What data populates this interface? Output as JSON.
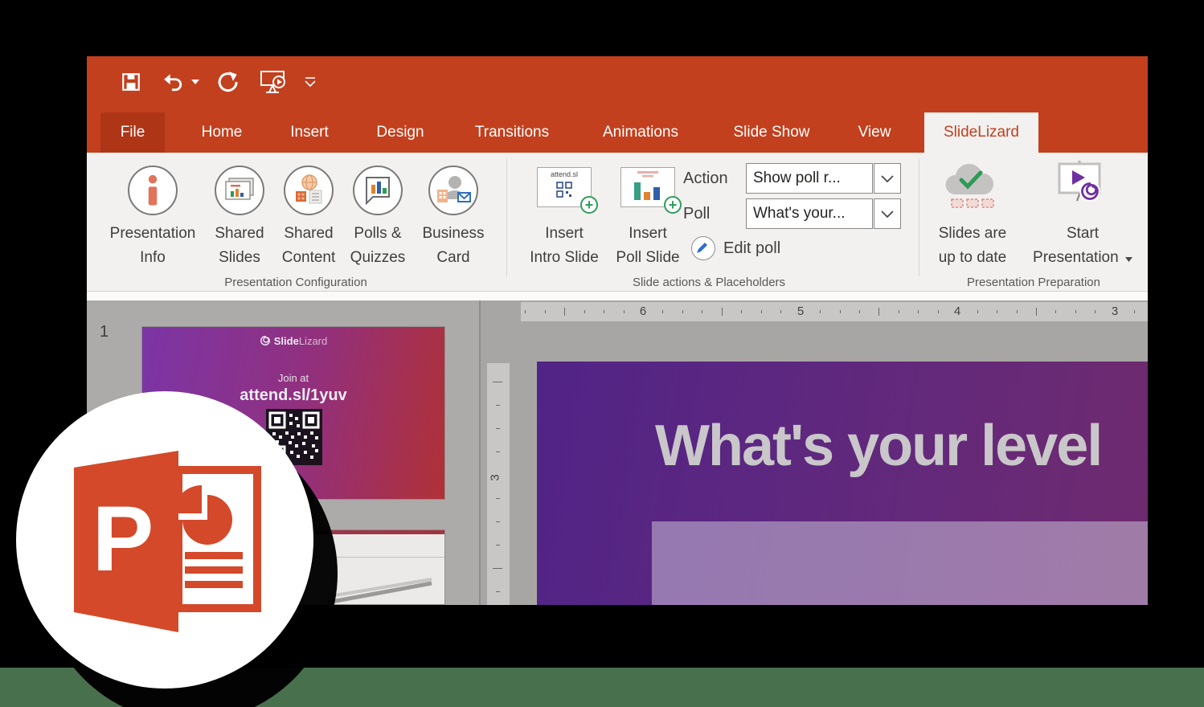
{
  "tabs": {
    "items": [
      {
        "label": "File"
      },
      {
        "label": "Home"
      },
      {
        "label": "Insert"
      },
      {
        "label": "Design"
      },
      {
        "label": "Transitions"
      },
      {
        "label": "Animations"
      },
      {
        "label": "Slide Show"
      },
      {
        "label": "View"
      },
      {
        "label": "SlideLizard"
      }
    ],
    "active": "SlideLizard"
  },
  "qat": {
    "icons": [
      "save",
      "undo",
      "undo-dropdown",
      "redo",
      "start-from-beginning",
      "customize-quick-access"
    ]
  },
  "ribbon": {
    "groups": [
      {
        "label": "Presentation Configuration",
        "buttons": [
          {
            "line1": "Presentation",
            "line2": "Info",
            "icon": "presentation-info"
          },
          {
            "line1": "Shared",
            "line2": "Slides",
            "icon": "shared-slides"
          },
          {
            "line1": "Shared",
            "line2": "Content",
            "icon": "shared-content"
          },
          {
            "line1": "Polls &",
            "line2": "Quizzes",
            "icon": "polls-quizzes"
          },
          {
            "line1": "Business",
            "line2": "Card",
            "icon": "business-card"
          }
        ]
      },
      {
        "label": "Slide actions & Placeholders",
        "buttons": [
          {
            "line1": "Insert",
            "line2": "Intro Slide",
            "icon": "insert-intro-slide"
          },
          {
            "line1": "Insert",
            "line2": "Poll Slide",
            "icon": "insert-poll-slide"
          }
        ],
        "intro_icon_text": "attend.sl",
        "action_label": "Action",
        "action_value": "Show poll r...",
        "poll_label": "Poll",
        "poll_value": "What's your...",
        "edit_poll_label": "Edit poll"
      },
      {
        "label": "Presentation Preparation",
        "buttons": [
          {
            "line1": "Slides are",
            "line2": "up to date",
            "icon": "slides-up-to-date"
          },
          {
            "line1": "Start",
            "line2": "Presentation",
            "icon": "start-presentation"
          }
        ]
      }
    ]
  },
  "slide_panel": {
    "slide_number": "1",
    "thumbnail1": {
      "brand_bold": "Slide",
      "brand_light": "Lizard",
      "join": "Join at",
      "url": "attend.sl/1yuv"
    }
  },
  "rulers": {
    "horizontal": [
      "6",
      "5",
      "4",
      "3"
    ],
    "vertical": "3"
  },
  "slide": {
    "title": "What's your level"
  },
  "colors": {
    "ribbon_red": "#c2401e",
    "file_tab_red": "#ae3516",
    "active_tab_text": "#c2401e",
    "ribbon_bg": "#f2f1f0",
    "canvas_gray": "#a8a6a5",
    "panel_gray": "#adaaaa",
    "slide_gradient_start": "#512487",
    "slide_gradient_end": "#6f2a6e",
    "thumb_gradient_start": "#7b35a6",
    "thumb_gradient_end": "#b03136",
    "title_text": "#c9c7c9",
    "plus_green": "#2e9e5c",
    "spiral_purple": "#7030a0",
    "pp_logo_red": "#d3492a",
    "green_band": "#48704d"
  }
}
